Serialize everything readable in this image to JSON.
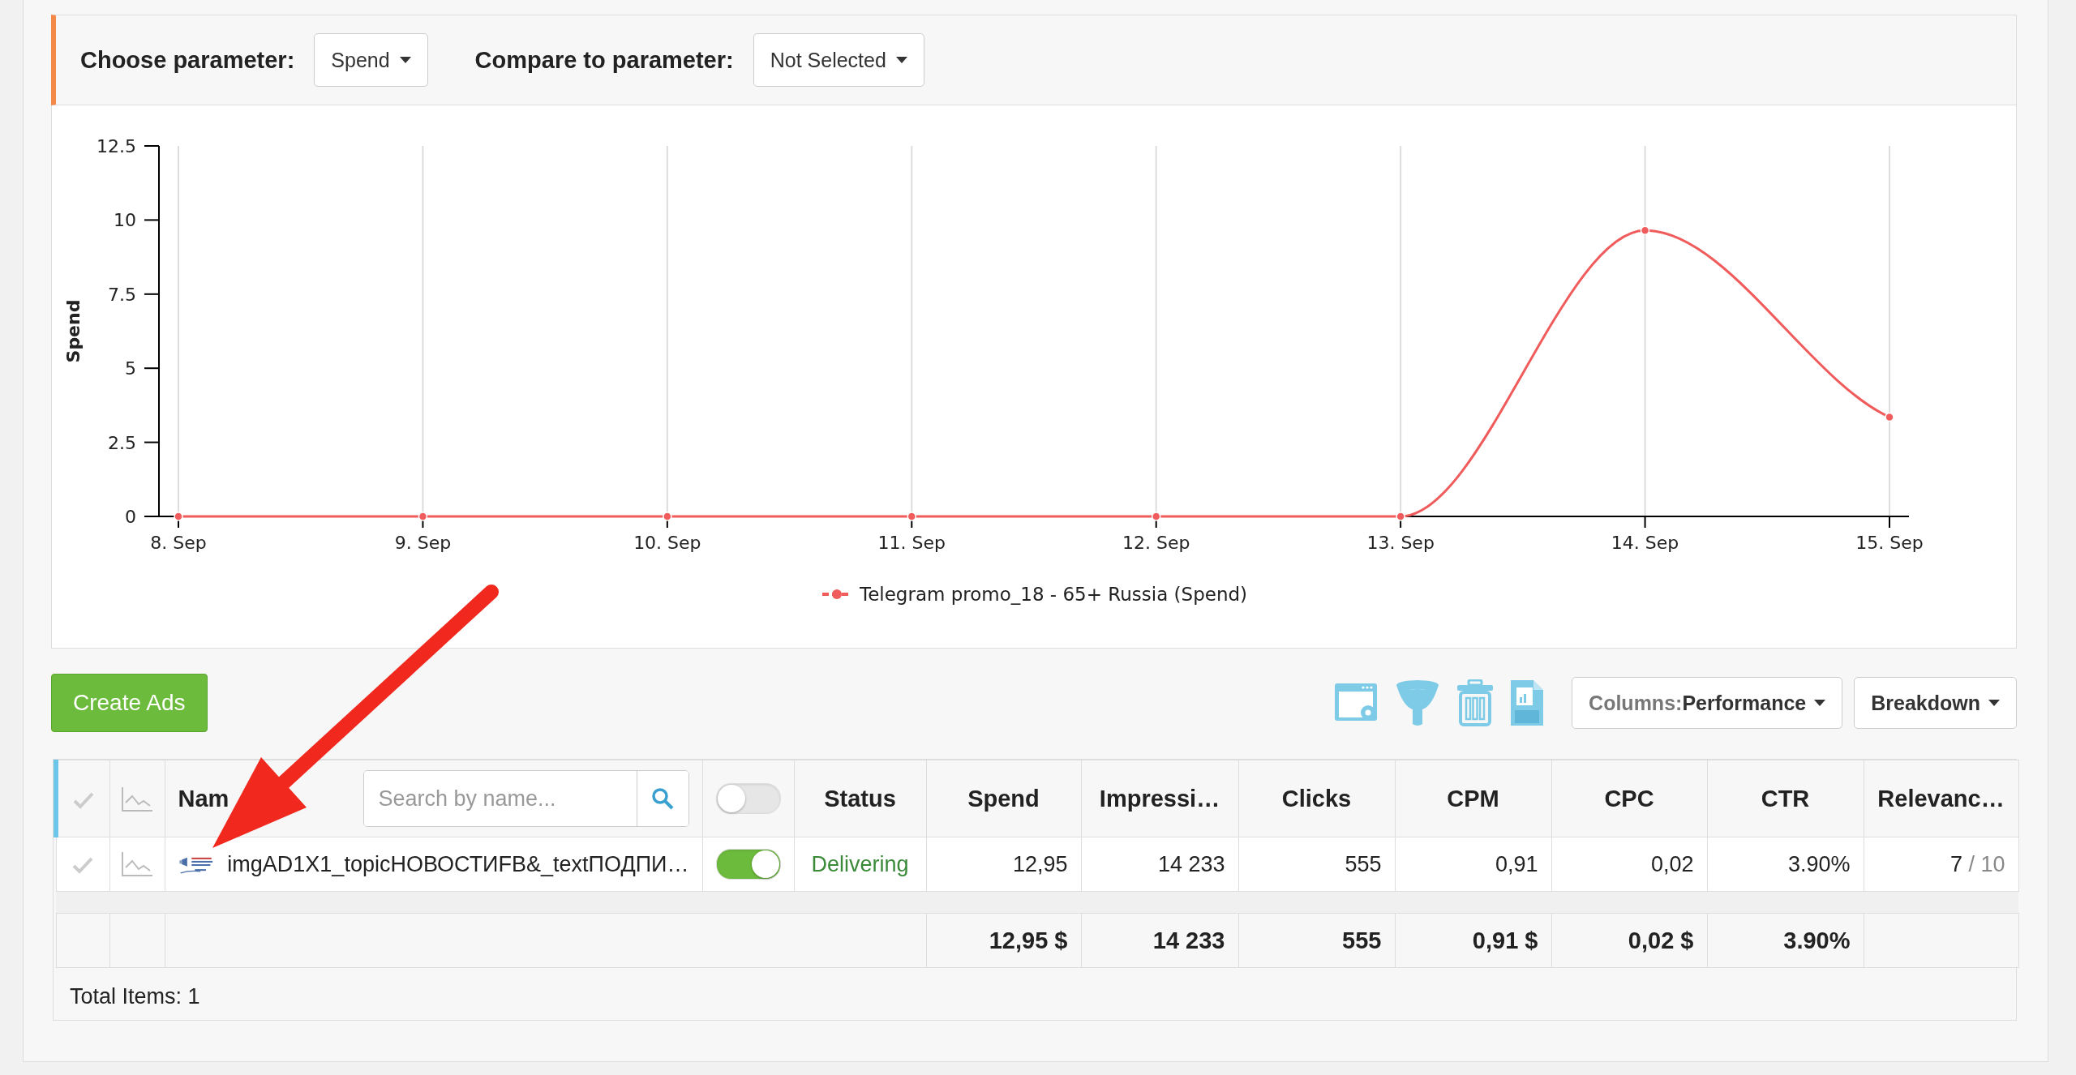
{
  "parameter_bar": {
    "choose_label": "Choose parameter:",
    "choose_value": "Spend",
    "compare_label": "Compare to parameter:",
    "compare_value": "Not Selected"
  },
  "chart": {
    "chart_data": {
      "type": "line",
      "ylabel": "Spend",
      "grid": true,
      "categories": [
        "8. Sep",
        "9. Sep",
        "10. Sep",
        "11. Sep",
        "12. Sep",
        "13. Sep",
        "14. Sep",
        "15. Sep"
      ],
      "series": [
        {
          "name": "Telegram promo_18 - 65+ Russia (Spend)",
          "color": "#f05b5b",
          "marker": true,
          "values": [
            0,
            0,
            0,
            0,
            0,
            0,
            9.65,
            3.35
          ]
        }
      ],
      "ylim": [
        0,
        12.5
      ],
      "yticks": [
        0,
        2.5,
        5,
        7.5,
        10,
        12.5
      ]
    }
  },
  "toolbar": {
    "create_button": "Create Ads",
    "columns_label": "Columns:",
    "columns_value": "Performance",
    "breakdown_button": "Breakdown"
  },
  "table": {
    "search_placeholder": "Search by name...",
    "header_toggle_on": false,
    "columns": [
      "Nam",
      "Status",
      "Spend",
      "Impressi…",
      "Clicks",
      "CPM",
      "CPC",
      "CTR",
      "Relevanc…"
    ],
    "rows": [
      {
        "selected": false,
        "on": true,
        "cells": [
          "imgAD1X1_topicНОВОСТИFB&_textПОДПИ…",
          "Delivering",
          "12,95",
          "14 233",
          "555",
          "0,91",
          "0,02",
          "3.90%"
        ],
        "relevance": "7",
        "relevance_max": "/ 10"
      }
    ],
    "totals": [
      "12,95 $",
      "14 233",
      "555",
      "0,91 $",
      "0,02 $",
      "3.90%"
    ],
    "total_items": "Total Items: 1"
  }
}
